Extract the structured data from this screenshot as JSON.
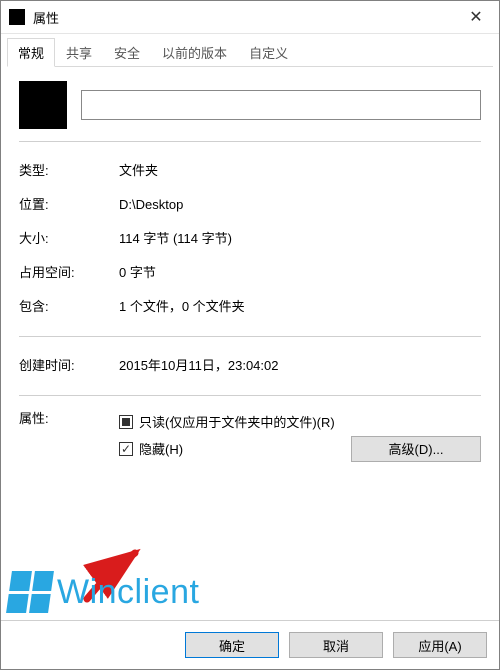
{
  "titlebar": {
    "title": "属性"
  },
  "tabs": [
    {
      "label": "常规"
    },
    {
      "label": "共享"
    },
    {
      "label": "安全"
    },
    {
      "label": "以前的版本"
    },
    {
      "label": "自定义"
    }
  ],
  "fields": {
    "name_value": "",
    "type_label": "类型:",
    "type_value": "文件夹",
    "location_label": "位置:",
    "location_value": "D:\\Desktop",
    "size_label": "大小:",
    "size_value": "114 字节 (114 字节)",
    "disk_label": "占用空间:",
    "disk_value": "0 字节",
    "contains_label": "包含:",
    "contains_value": "1 个文件，0 个文件夹",
    "created_label": "创建时间:",
    "created_value": "2015年10月11日，23:04:02",
    "attr_label": "属性:"
  },
  "attributes": {
    "readonly_label": "只读(仅应用于文件夹中的文件)(R)",
    "hidden_label": "隐藏(H)",
    "readonly_state": "indeterminate",
    "hidden_state": "checked",
    "advanced_label": "高级(D)..."
  },
  "buttons": {
    "ok": "确定",
    "cancel": "取消",
    "apply": "应用(A)"
  },
  "watermark": {
    "text": "Winclient"
  }
}
